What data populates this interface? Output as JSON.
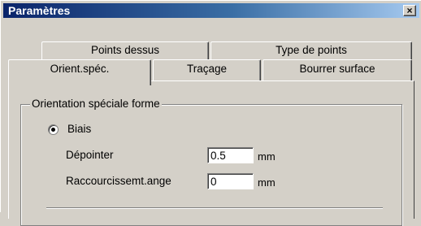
{
  "window": {
    "title": "Paramètres",
    "close_label": "×"
  },
  "tabs": {
    "row1": [
      {
        "label": "Points dessus"
      },
      {
        "label": "Type de points"
      }
    ],
    "row2": [
      {
        "label": "Orient.spéc.",
        "active": true
      },
      {
        "label": "Traçage"
      },
      {
        "label": "Bourrer surface"
      }
    ]
  },
  "group": {
    "title": "Orientation spéciale forme",
    "radio_label": "Biais",
    "radio_checked": true,
    "fields": [
      {
        "label": "Dépointer",
        "value": "0.5",
        "unit": "mm"
      },
      {
        "label": "Raccourcissemt.ange",
        "value": "0",
        "unit": "mm"
      }
    ]
  }
}
